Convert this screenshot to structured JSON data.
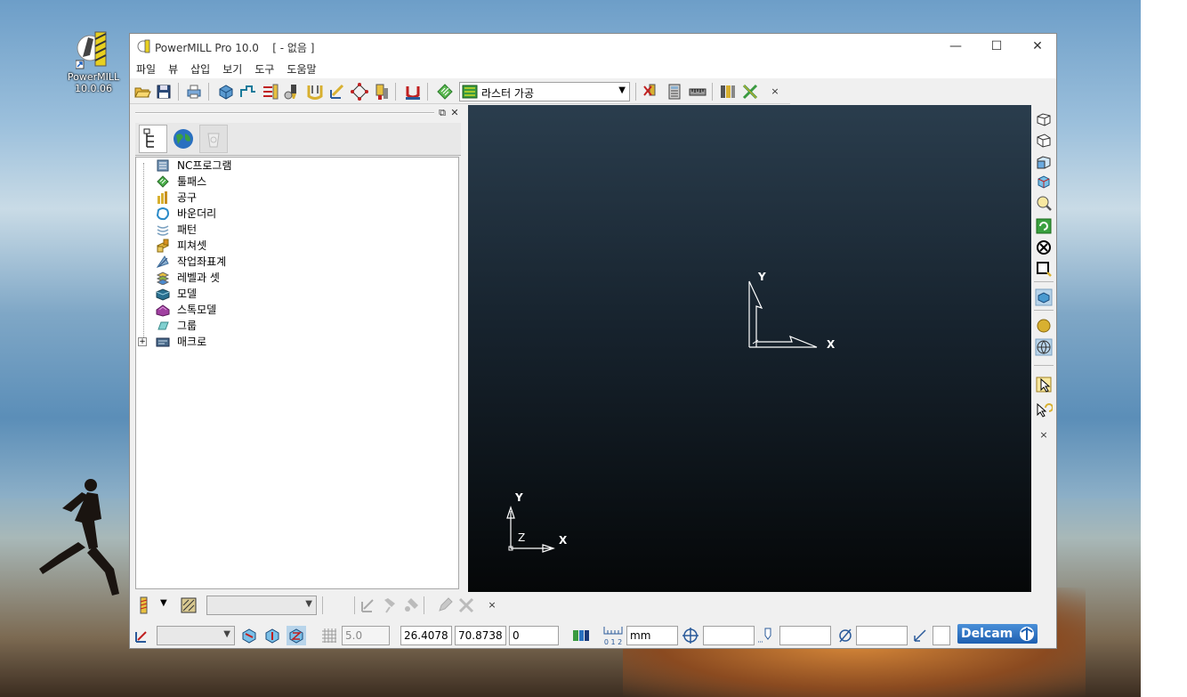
{
  "desktop": {
    "icon_label_line1": "PowerMILL",
    "icon_label_line2": "10.0.06"
  },
  "window": {
    "title": "PowerMILL Pro 10.0",
    "project": "[  - 없음 ]",
    "minimize": "—",
    "maximize": "☐",
    "close": "✕"
  },
  "menu": {
    "items": [
      "파일",
      "뷰",
      "삽입",
      "보기",
      "도구",
      "도움말"
    ]
  },
  "toolbar": {
    "strategy_select": "라스터 가공",
    "close": "×"
  },
  "explorer": {
    "tree": [
      {
        "label": "NC프로그램",
        "icon": "nc-program-icon",
        "color": "#5a7a9a"
      },
      {
        "label": "툴패스",
        "icon": "toolpath-icon",
        "color": "#3aa040"
      },
      {
        "label": "공구",
        "icon": "tool-icon",
        "color": "#c8a020"
      },
      {
        "label": "바운더리",
        "icon": "boundary-icon",
        "color": "#2a8ac8"
      },
      {
        "label": "패턴",
        "icon": "pattern-icon",
        "color": "#7aa0c0"
      },
      {
        "label": "피쳐셋",
        "icon": "featureset-icon",
        "color": "#d8a030"
      },
      {
        "label": "작업좌표계",
        "icon": "workplane-icon",
        "color": "#5a90c0"
      },
      {
        "label": "레벨과 셋",
        "icon": "levels-icon",
        "color": "#8ab040"
      },
      {
        "label": "모델",
        "icon": "model-icon",
        "color": "#2a7090"
      },
      {
        "label": "스톡모델",
        "icon": "stock-model-icon",
        "color": "#a040a0"
      },
      {
        "label": "그룹",
        "icon": "group-icon",
        "color": "#70c0c0"
      },
      {
        "label": "매크로",
        "icon": "macro-icon",
        "color": "#4a6a8a"
      }
    ]
  },
  "viewport": {
    "axis_x": "X",
    "axis_y": "Y",
    "axis_z": "Z"
  },
  "status": {
    "grid_value": "5.0",
    "coord_x": "26.4078",
    "coord_y": "70.8738",
    "coord_z": "0",
    "ruler_digits": "0 1 2",
    "units": "mm",
    "brand": "Delcam",
    "close": "×"
  }
}
